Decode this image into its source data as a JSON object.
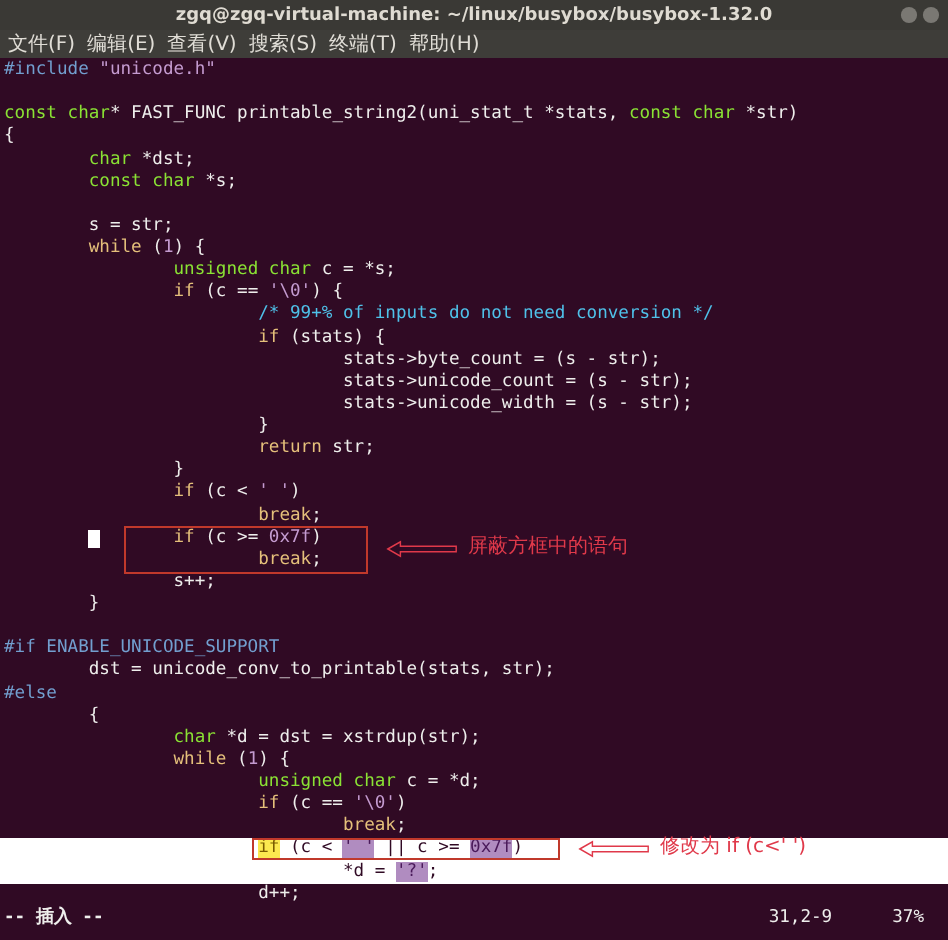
{
  "window": {
    "title": "zgq@zgq-virtual-machine: ~/linux/busybox/busybox-1.32.0"
  },
  "menu": [
    "文件(F)",
    "编辑(E)",
    "查看(V)",
    "搜索(S)",
    "终端(T)",
    "帮助(H)"
  ],
  "lines": [
    {
      "segments": [
        {
          "kind": "preproc",
          "text": "#include"
        },
        {
          "kind": "string",
          "text": " \"unicode.h\""
        }
      ]
    },
    {
      "kind": "blank"
    },
    {
      "kind": "code",
      "segments": [
        {
          "kind": "type",
          "text": "const"
        },
        {
          "kind": "type",
          "text": " char"
        },
        {
          "kind": "plain",
          "text": "* FAST_FUNC printable_string2(uni_stat_t *stats, "
        },
        {
          "kind": "type",
          "text": "const"
        },
        {
          "kind": "type",
          "text": " char"
        },
        {
          "kind": "plain",
          "text": " *str)"
        }
      ]
    },
    {
      "segments": [
        {
          "kind": "plain",
          "text": "{"
        }
      ]
    },
    {
      "segments": [
        {
          "kind": "type",
          "text": "\tchar"
        },
        {
          "kind": "plain",
          "text": " *dst;"
        }
      ]
    },
    {
      "segments": [
        {
          "kind": "type",
          "text": "\tconst"
        },
        {
          "kind": "type",
          "text": " char"
        },
        {
          "kind": "plain",
          "text": " *s;"
        }
      ]
    },
    {
      "kind": "blank"
    },
    {
      "segments": [
        {
          "kind": "plain",
          "text": "\ts = str;"
        }
      ]
    },
    {
      "segments": [
        {
          "kind": "keyword",
          "text": "\twhile"
        },
        {
          "kind": "plain",
          "text": " ("
        },
        {
          "kind": "string",
          "text": "1"
        },
        {
          "kind": "plain",
          "text": ") {"
        }
      ]
    },
    {
      "segments": [
        {
          "kind": "type",
          "text": "\t\tunsigned"
        },
        {
          "kind": "type",
          "text": " char"
        },
        {
          "kind": "plain",
          "text": " c = *s;"
        }
      ]
    },
    {
      "segments": [
        {
          "kind": "keyword",
          "text": "\t\tif"
        },
        {
          "kind": "plain",
          "text": " (c == "
        },
        {
          "kind": "string",
          "text": "'\\0'"
        },
        {
          "kind": "plain",
          "text": ") {"
        }
      ]
    },
    {
      "segments": [
        {
          "kind": "comment",
          "text": "\t\t\t/* 99+% of inputs do not need conversion */"
        }
      ]
    },
    {
      "segments": [
        {
          "kind": "keyword",
          "text": "\t\t\tif"
        },
        {
          "kind": "plain",
          "text": " (stats) {"
        }
      ]
    },
    {
      "segments": [
        {
          "kind": "plain",
          "text": "\t\t\t\tstats->byte_count = (s - str);"
        }
      ]
    },
    {
      "segments": [
        {
          "kind": "plain",
          "text": "\t\t\t\tstats->unicode_count = (s - str);"
        }
      ]
    },
    {
      "segments": [
        {
          "kind": "plain",
          "text": "\t\t\t\tstats->unicode_width = (s - str);"
        }
      ]
    },
    {
      "segments": [
        {
          "kind": "plain",
          "text": "\t\t\t}"
        }
      ]
    },
    {
      "segments": [
        {
          "kind": "keyword",
          "text": "\t\t\treturn"
        },
        {
          "kind": "plain",
          "text": " str;"
        }
      ]
    },
    {
      "segments": [
        {
          "kind": "plain",
          "text": "\t\t}"
        }
      ]
    },
    {
      "segments": [
        {
          "kind": "keyword",
          "text": "\t\tif"
        },
        {
          "kind": "plain",
          "text": " (c < "
        },
        {
          "kind": "string",
          "text": "' '"
        },
        {
          "kind": "plain",
          "text": ")"
        }
      ]
    },
    {
      "segments": [
        {
          "kind": "keyword",
          "text": "\t\t\tbreak"
        },
        {
          "kind": "plain",
          "text": ";"
        }
      ]
    },
    {
      "cursor": true,
      "annotation": {
        "kind": "block",
        "text": "屏蔽方框中的语句"
      },
      "segments": [
        {
          "kind": "keyword",
          "text": "\t\tif"
        },
        {
          "kind": "plain",
          "text": " (c >= "
        },
        {
          "kind": "string",
          "text": "0x7f"
        },
        {
          "kind": "plain",
          "text": ")"
        }
      ]
    },
    {
      "segments": [
        {
          "kind": "keyword",
          "text": "\t\t\tbreak"
        },
        {
          "kind": "plain",
          "text": ";"
        }
      ]
    },
    {
      "segments": [
        {
          "kind": "plain",
          "text": "\t\ts++;"
        }
      ]
    },
    {
      "segments": [
        {
          "kind": "plain",
          "text": "\t}"
        }
      ]
    },
    {
      "kind": "blank"
    },
    {
      "segments": [
        {
          "kind": "preproc",
          "text": "#if ENABLE_UNICODE_SUPPORT"
        }
      ]
    },
    {
      "segments": [
        {
          "kind": "plain",
          "text": "\tdst = unicode_conv_to_printable(stats, str);"
        }
      ]
    },
    {
      "segments": [
        {
          "kind": "preproc",
          "text": "#else"
        }
      ]
    },
    {
      "segments": [
        {
          "kind": "plain",
          "text": "\t{"
        }
      ]
    },
    {
      "segments": [
        {
          "kind": "type",
          "text": "\t\tchar"
        },
        {
          "kind": "plain",
          "text": " *d = dst = xstrdup(str);"
        }
      ]
    },
    {
      "segments": [
        {
          "kind": "keyword",
          "text": "\t\twhile"
        },
        {
          "kind": "plain",
          "text": " ("
        },
        {
          "kind": "string",
          "text": "1"
        },
        {
          "kind": "plain",
          "text": ") {"
        }
      ]
    },
    {
      "segments": [
        {
          "kind": "type",
          "text": "\t\t\tunsigned"
        },
        {
          "kind": "type",
          "text": " char"
        },
        {
          "kind": "plain",
          "text": " c = *d;"
        }
      ]
    },
    {
      "segments": [
        {
          "kind": "keyword",
          "text": "\t\t\tif"
        },
        {
          "kind": "plain",
          "text": " (c == "
        },
        {
          "kind": "string",
          "text": "'\\0'"
        },
        {
          "kind": "plain",
          "text": ")"
        }
      ]
    },
    {
      "segments": [
        {
          "kind": "keyword",
          "text": "\t\t\t\tbreak"
        },
        {
          "kind": "plain",
          "text": ";"
        }
      ]
    },
    {
      "highlighted": true,
      "annotation": {
        "kind": "inline",
        "text": "修改为  if (c<' ')"
      },
      "segments": [
        {
          "kind": "keyword",
          "text": "\t\t\tif",
          "match": true
        },
        {
          "kind": "plain",
          "text": " (c < "
        },
        {
          "kind": "string",
          "text": "' '",
          "match": true
        },
        {
          "kind": "plain",
          "text": " || c >= "
        },
        {
          "kind": "string",
          "text": "0x7f",
          "match": true
        },
        {
          "kind": "plain",
          "text": ")"
        }
      ]
    },
    {
      "highlighted": true,
      "segments": [
        {
          "kind": "plain",
          "text": "\t\t\t\t*d = "
        },
        {
          "kind": "string",
          "text": "'?'",
          "match": true
        },
        {
          "kind": "plain",
          "text": ";"
        }
      ]
    },
    {
      "segments": [
        {
          "kind": "plain",
          "text": "\t\t\td++;"
        }
      ]
    }
  ],
  "status_bar": {
    "mode": "-- 插入 --",
    "position": "31,2-9",
    "scroll": "37%"
  }
}
